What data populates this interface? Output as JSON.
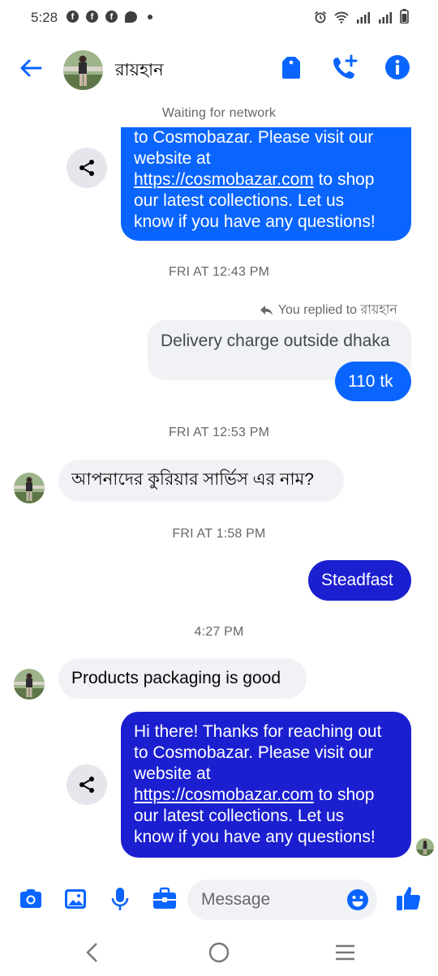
{
  "status_bar": {
    "time": "5:28"
  },
  "header": {
    "contact_name": "রায়হান"
  },
  "chat": {
    "network_status": "Waiting for network",
    "first_bubble_lines": [
      "to Cosmobazar. Please visit our",
      "website at"
    ],
    "first_bubble_link": "https://cosmobazar.com",
    "first_bubble_after_link": " to shop",
    "first_bubble_tail_lines": [
      "our latest collections. Let us",
      "know if you have any questions!"
    ],
    "ts_1": "FRI AT 12:43 PM",
    "replied_label": "You replied to রায়হান",
    "quoted_message": "Delivery charge outside dhaka",
    "reply_message": "110 tk",
    "ts_2": "FRI AT 12:53 PM",
    "incoming_1": "আপনাদের কুরিয়ার সার্ভিস এর নাম?",
    "ts_3": "FRI AT 1:58 PM",
    "outgoing_2": "Steadfast",
    "ts_4": "4:27 PM",
    "incoming_2": "Products packaging is good",
    "last_bubble_lines": [
      "Hi there! Thanks for reaching out",
      "to Cosmobazar. Please visit our",
      "website at"
    ],
    "last_bubble_link": "https://cosmobazar.com",
    "last_bubble_after_link": " to shop",
    "last_bubble_tail_lines": [
      "our latest collections. Let us",
      "know if you have any questions!"
    ]
  },
  "composer": {
    "placeholder": "Message"
  },
  "icons": {
    "back": "arrow-left-icon",
    "tag": "tag-icon",
    "add_call": "phone-plus-icon",
    "info": "info-icon",
    "share": "share-icon",
    "camera": "camera-icon",
    "gallery": "image-icon",
    "mic": "microphone-icon",
    "briefcase": "briefcase-icon",
    "emoji": "emoji-icon",
    "like": "thumbs-up-icon"
  },
  "colors": {
    "accent": "#0a65ff",
    "outgoing_dark": "#1b1fd0",
    "incoming_bg": "#f0f2f5",
    "muted_text": "#65676b"
  }
}
